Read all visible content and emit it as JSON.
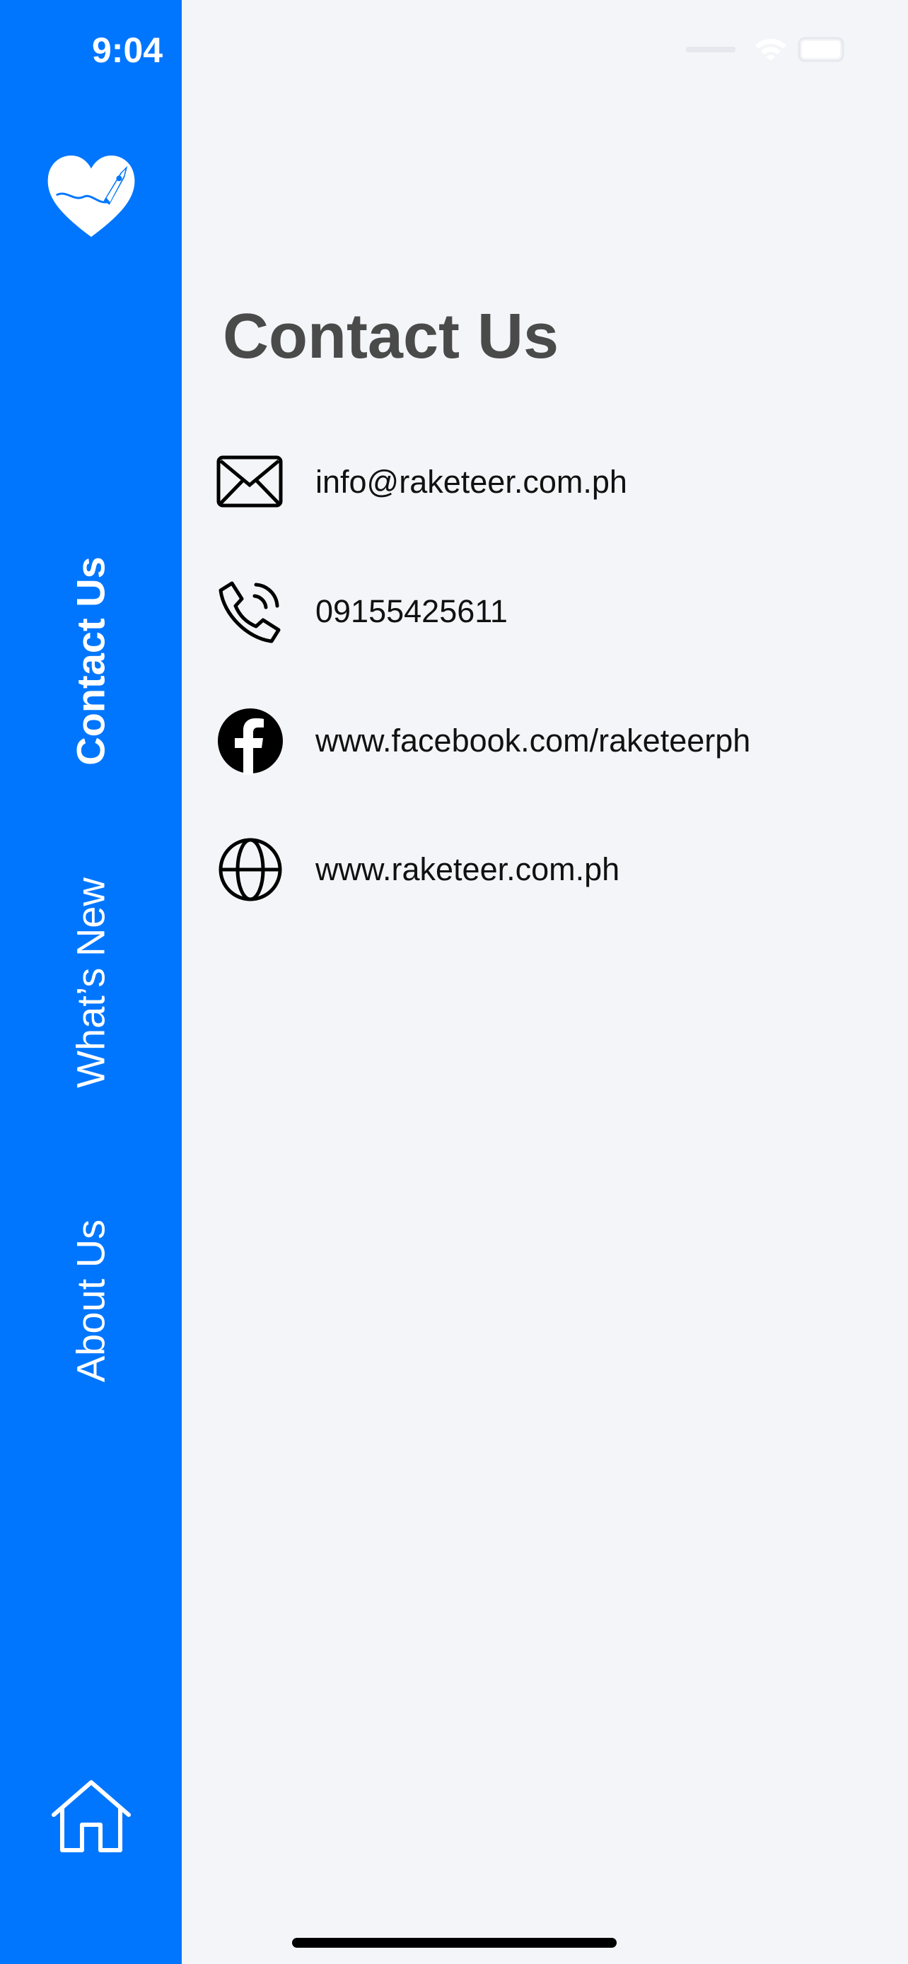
{
  "status_bar": {
    "time": "9:04"
  },
  "sidebar": {
    "items": [
      {
        "label": "Contact Us",
        "active": true
      },
      {
        "label": "What’s New",
        "active": false
      },
      {
        "label": "About Us",
        "active": false
      }
    ]
  },
  "main": {
    "title": "Contact Us",
    "contacts": [
      {
        "icon": "envelope-icon",
        "text": "info@raketeer.com.ph"
      },
      {
        "icon": "phone-icon",
        "text": "09155425611"
      },
      {
        "icon": "facebook-icon",
        "text": "www.facebook.com/raketeerph"
      },
      {
        "icon": "globe-icon",
        "text": "www.raketeer.com.ph"
      }
    ]
  },
  "colors": {
    "sidebar": "#0076fe",
    "background": "#f4f5f8",
    "title": "#4a4a4a"
  }
}
